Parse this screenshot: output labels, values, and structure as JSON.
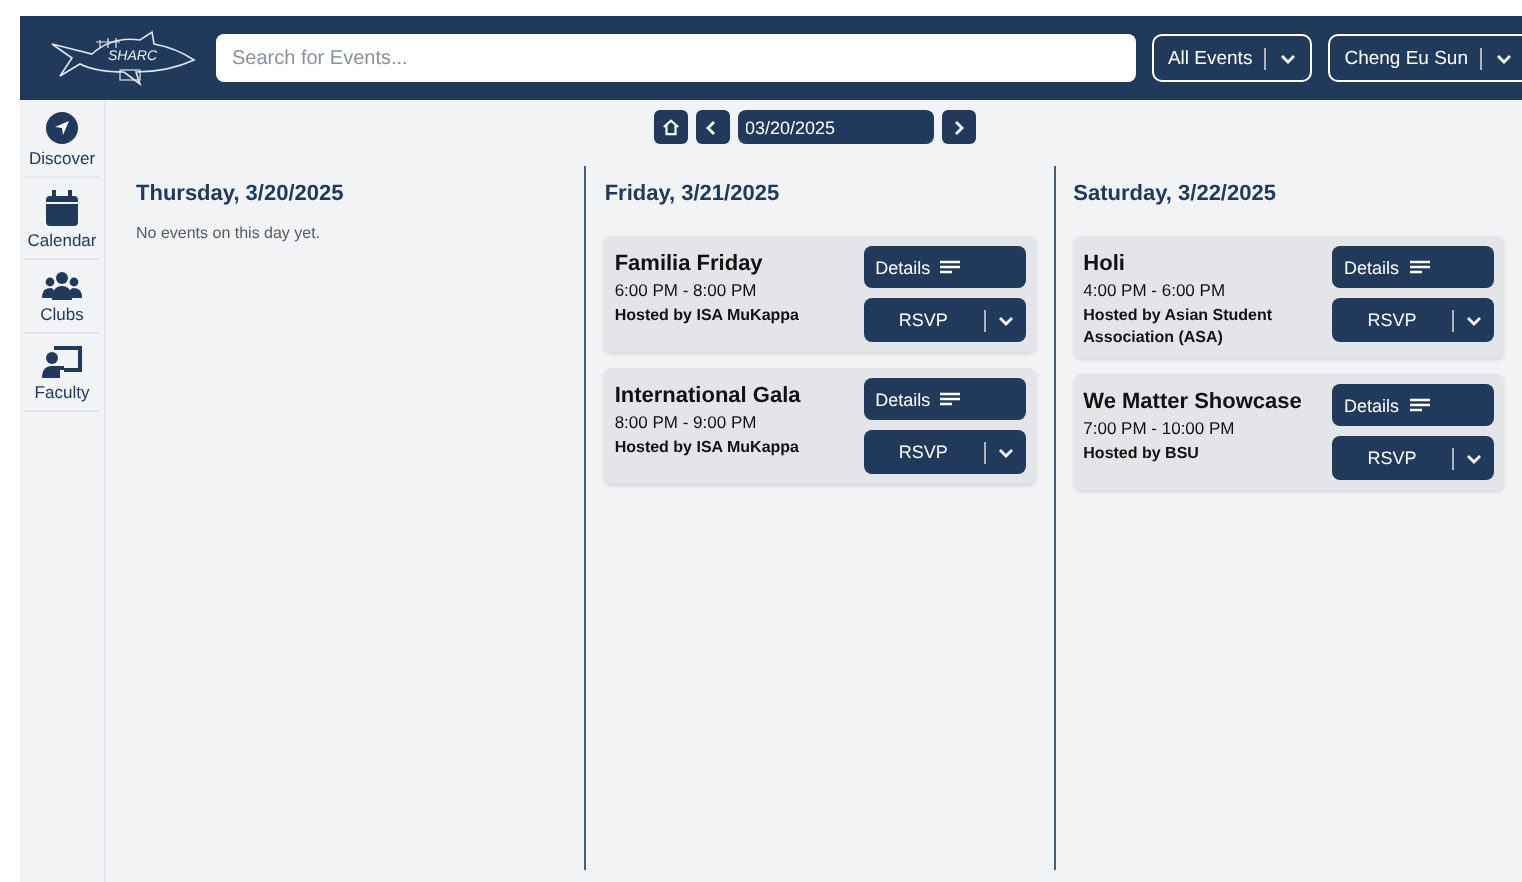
{
  "header": {
    "logo_text": "SHARC",
    "search": {
      "placeholder": "Search for Events..."
    },
    "filter": "All Events",
    "user": "Cheng Eu Sun"
  },
  "sidebar": {
    "items": [
      {
        "label": "Discover"
      },
      {
        "label": "Calendar"
      },
      {
        "label": "Clubs"
      },
      {
        "label": "Faculty"
      }
    ]
  },
  "date_nav": {
    "date": "03/20/2025"
  },
  "days": [
    {
      "title": "Thursday, 3/20/2025",
      "empty_text": "No events on this day yet."
    },
    {
      "title": "Friday, 3/21/2025",
      "events": [
        {
          "name": "Familia Friday",
          "time": "6:00 PM - 8:00 PM",
          "host": "Hosted by ISA MuKappa",
          "details": "Details",
          "rsvp": "RSVP"
        },
        {
          "name": "International Gala",
          "time": "8:00 PM - 9:00 PM",
          "host": "Hosted by ISA MuKappa",
          "details": "Details",
          "rsvp": "RSVP"
        }
      ]
    },
    {
      "title": "Saturday, 3/22/2025",
      "events": [
        {
          "name": "Holi",
          "time": "4:00 PM - 6:00 PM",
          "host": "Hosted by Asian Student Association (ASA)",
          "details": "Details",
          "rsvp": "RSVP"
        },
        {
          "name": "We Matter Showcase",
          "time": "7:00 PM - 10:00 PM",
          "host": "Hosted by BSU",
          "details": "Details",
          "rsvp": "RSVP"
        }
      ]
    }
  ]
}
